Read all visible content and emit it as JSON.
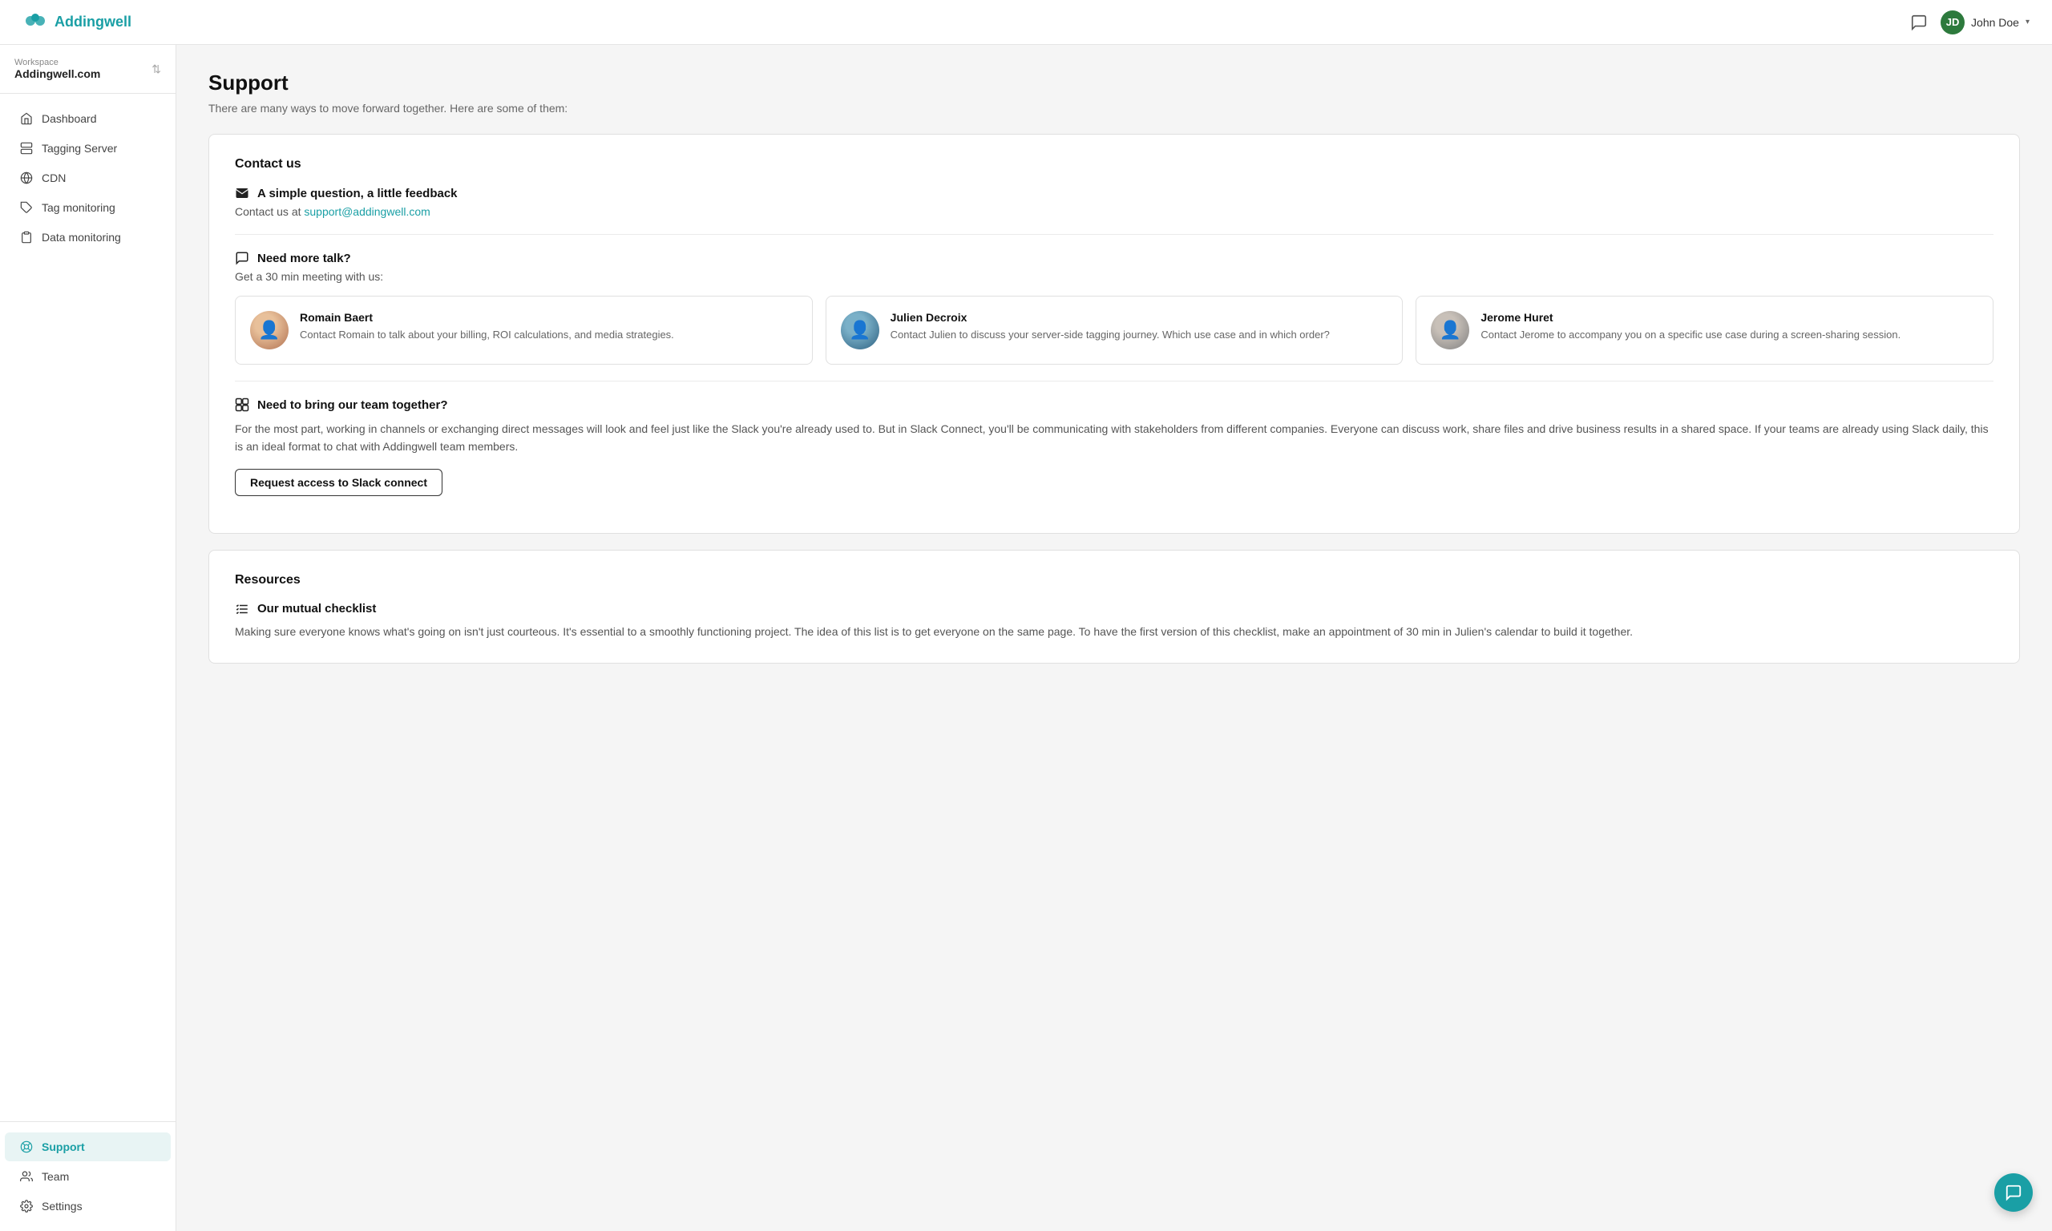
{
  "app": {
    "logo_text": "Addingwell",
    "user_name": "John Doe"
  },
  "workspace": {
    "label": "Workspace",
    "name": "Addingwell.com"
  },
  "nav": {
    "items": [
      {
        "id": "dashboard",
        "label": "Dashboard",
        "icon": "home"
      },
      {
        "id": "tagging-server",
        "label": "Tagging Server",
        "icon": "server"
      },
      {
        "id": "cdn",
        "label": "CDN",
        "icon": "globe"
      },
      {
        "id": "tag-monitoring",
        "label": "Tag monitoring",
        "icon": "tag"
      },
      {
        "id": "data-monitoring",
        "label": "Data monitoring",
        "icon": "clipboard"
      }
    ],
    "bottom_items": [
      {
        "id": "support",
        "label": "Support",
        "icon": "support",
        "active": true
      },
      {
        "id": "team",
        "label": "Team",
        "icon": "users"
      },
      {
        "id": "settings",
        "label": "Settings",
        "icon": "gear"
      }
    ]
  },
  "page": {
    "title": "Support",
    "subtitle": "There are many ways to move forward together. Here are some of them:"
  },
  "contact_card": {
    "title": "Contact us",
    "email_section": {
      "heading": "A simple question, a little feedback",
      "body": "Contact us at ",
      "email": "support@addingwell.com"
    },
    "meeting_section": {
      "heading": "Need more talk?",
      "subheading": "Get a 30 min meeting with us:",
      "people": [
        {
          "name": "Romain Baert",
          "desc": "Contact Romain to talk about your billing, ROI calculations, and media strategies.",
          "avatar_class": "av-romain"
        },
        {
          "name": "Julien Decroix",
          "desc": "Contact Julien to discuss your server-side tagging journey. Which use case and in which order?",
          "avatar_class": "av-julien"
        },
        {
          "name": "Jerome Huret",
          "desc": "Contact Jerome to accompany you on a specific use case during a screen-sharing session.",
          "avatar_class": "av-jerome"
        }
      ]
    },
    "slack_section": {
      "heading": "Need to bring our team together?",
      "desc": "For the most part, working in channels or exchanging direct messages will look and feel just like the Slack you're already used to. But in Slack Connect, you'll be communicating with stakeholders from different companies. Everyone can discuss work, share files and drive business results in a shared space. If your teams are already using Slack daily, this is an ideal format to chat with Addingwell team members.",
      "button_label": "Request access to Slack connect"
    }
  },
  "resources_card": {
    "title": "Resources",
    "checklist_section": {
      "heading": "Our mutual checklist",
      "desc": "Making sure everyone knows what's going on isn't just courteous. It's essential to a smoothly functioning project. The idea of this list is to get everyone on the same page. To have the first version of this checklist, make an appointment of 30 min in Julien's calendar to build it together."
    }
  }
}
